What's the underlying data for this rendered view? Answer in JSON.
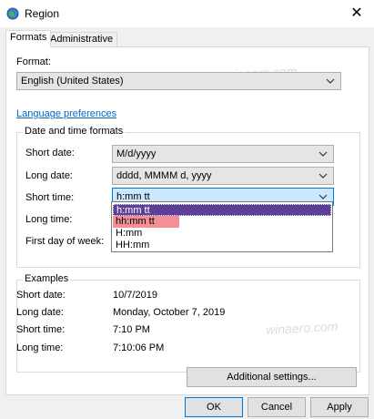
{
  "window": {
    "title": "Region",
    "close_glyph": "✕",
    "icon": "globe-icon"
  },
  "tabs": [
    {
      "label": "Formats",
      "active": true
    },
    {
      "label": "Administrative",
      "active": false
    }
  ],
  "format": {
    "label": "Format:",
    "value": "English (United States)"
  },
  "language_link": "Language preferences",
  "date_time_group": {
    "legend": "Date and time formats",
    "short_date": {
      "label": "Short date:",
      "value": "M/d/yyyy"
    },
    "long_date": {
      "label": "Long date:",
      "value": "dddd, MMMM d, yyyy"
    },
    "short_time": {
      "label": "Short time:",
      "value": "h:mm tt"
    },
    "long_time": {
      "label": "Long time:"
    },
    "first_day": {
      "label": "First day of week:"
    },
    "short_time_options": [
      "h:mm tt",
      "hh:mm tt",
      "H:mm",
      "HH:mm"
    ]
  },
  "examples": {
    "legend": "Examples",
    "rows": [
      {
        "label": "Short date:",
        "value": "10/7/2019"
      },
      {
        "label": "Long date:",
        "value": "Monday, October 7, 2019"
      },
      {
        "label": "Short time:",
        "value": "7:10 PM"
      },
      {
        "label": "Long time:",
        "value": "7:10:06 PM"
      }
    ]
  },
  "buttons": {
    "additional": "Additional settings...",
    "ok": "OK",
    "cancel": "Cancel",
    "apply": "Apply"
  },
  "watermark": "winaero.com",
  "colors": {
    "accent": "#0078d7",
    "selected_option": "#5c3f97",
    "hover_option": "#f48f95",
    "link": "#0066cc"
  }
}
